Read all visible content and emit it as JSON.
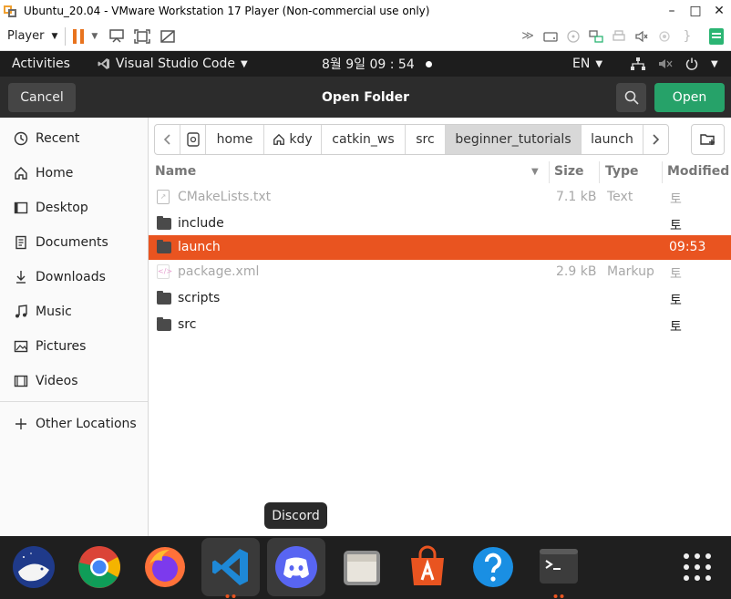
{
  "vm_window": {
    "title": "Ubuntu_20.04 - VMware Workstation 17 Player (Non-commercial use only)",
    "minimize": "–",
    "maximize": "□",
    "close": "✕"
  },
  "vm_toolbar": {
    "player_label": "Player",
    "accent": "#e8731e"
  },
  "topbar": {
    "activities": "Activities",
    "app_name": "Visual Studio Code",
    "clock": "8월 9일 09 : 54",
    "language": "EN"
  },
  "dialog": {
    "title": "Open Folder",
    "cancel_label": "Cancel",
    "open_label": "Open",
    "open_color": "#26a269"
  },
  "sidebar": {
    "items": [
      {
        "label": "Recent",
        "icon": "clock-icon"
      },
      {
        "label": "Home",
        "icon": "home-icon"
      },
      {
        "label": "Desktop",
        "icon": "desktop-icon"
      },
      {
        "label": "Documents",
        "icon": "documents-icon"
      },
      {
        "label": "Downloads",
        "icon": "download-icon"
      },
      {
        "label": "Music",
        "icon": "music-icon"
      },
      {
        "label": "Pictures",
        "icon": "pictures-icon"
      },
      {
        "label": "Videos",
        "icon": "videos-icon"
      }
    ],
    "other_locations": "Other Locations"
  },
  "pathbar": {
    "segments": [
      "home",
      "kdy",
      "catkin_ws",
      "src",
      "beginner_tutorials",
      "launch"
    ],
    "active": "beginner_tutorials"
  },
  "columns": {
    "name": "Name",
    "size": "Size",
    "type": "Type",
    "modified": "Modified"
  },
  "files": [
    {
      "name": "CMakeLists.txt",
      "size": "7.1 kB",
      "type": "Text",
      "modified": "토",
      "kind": "file",
      "dim": true
    },
    {
      "name": "include",
      "size": "",
      "type": "",
      "modified": "토",
      "kind": "folder",
      "dim": false
    },
    {
      "name": "launch",
      "size": "",
      "type": "",
      "modified": "09:53",
      "kind": "folder",
      "dim": false,
      "selected": true
    },
    {
      "name": "package.xml",
      "size": "2.9 kB",
      "type": "Markup",
      "modified": "토",
      "kind": "file",
      "dim": true
    },
    {
      "name": "scripts",
      "size": "",
      "type": "",
      "modified": "토",
      "kind": "folder",
      "dim": false
    },
    {
      "name": "src",
      "size": "",
      "type": "",
      "modified": "토",
      "kind": "folder",
      "dim": false
    }
  ],
  "selection_color": "#e95420",
  "tooltip": "Discord",
  "dock": [
    {
      "name": "deepin-whale-app"
    },
    {
      "name": "chrome-app"
    },
    {
      "name": "firefox-app"
    },
    {
      "name": "vscode-app"
    },
    {
      "name": "discord-app"
    },
    {
      "name": "files-app"
    },
    {
      "name": "software-center-app"
    },
    {
      "name": "help-app"
    },
    {
      "name": "terminal-app"
    },
    {
      "name": "show-apps"
    }
  ]
}
